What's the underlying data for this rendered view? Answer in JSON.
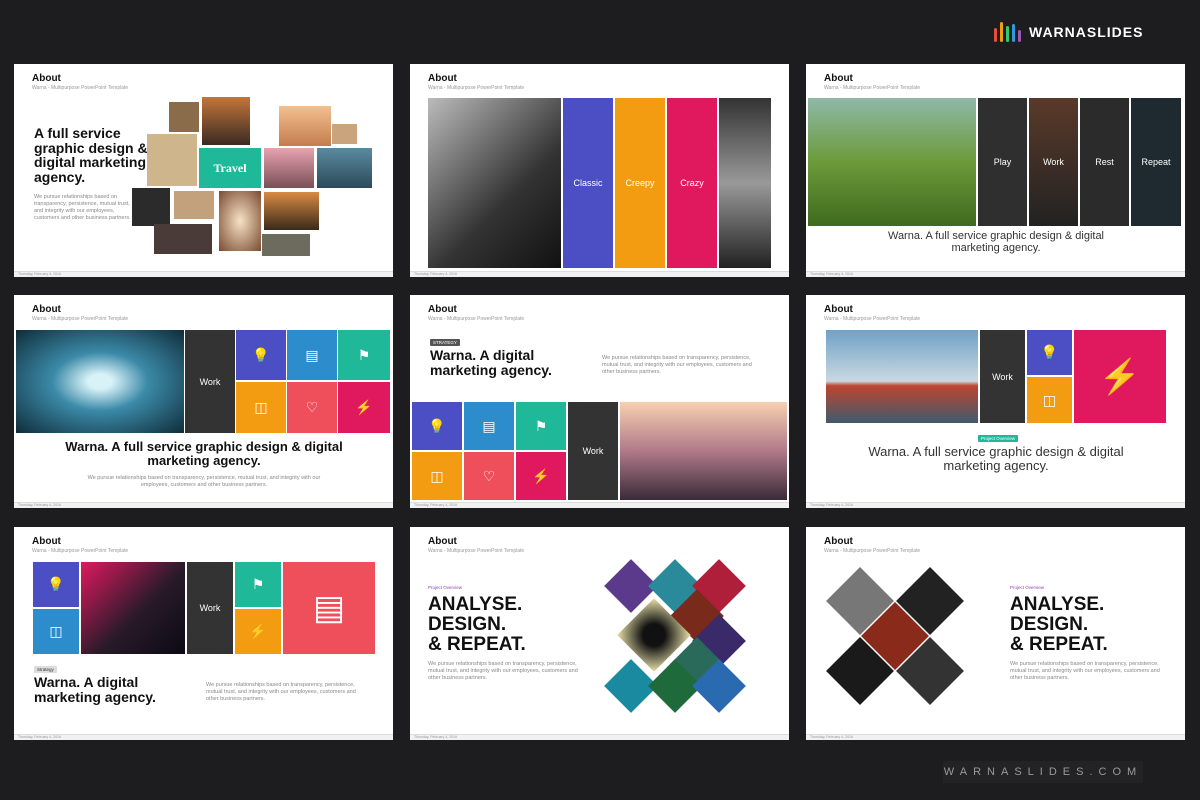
{
  "brand": {
    "name": "WARNASLIDES",
    "footer": "WARNASLIDES.COM"
  },
  "common": {
    "title": "About",
    "subtitle": "Warna - Multipurpose PowerPoint Template",
    "footer": "Thursday, February 4, 2016"
  },
  "s1": {
    "heading": "A full service graphic design & digital marketing agency.",
    "para": "We pursue relationships based on transparency, persistence, mutual trust, and integrity with our employees, customers and other business partners.",
    "tile": "Travel"
  },
  "s2": {
    "labels": [
      "Classic",
      "Creepy",
      "Crazy"
    ]
  },
  "s3": {
    "labels": [
      "Play",
      "Work",
      "Rest",
      "Repeat"
    ],
    "caption": "Warna. A full service graphic design & digital marketing agency."
  },
  "s4": {
    "work": "Work",
    "heading": "Warna. A full service graphic design & digital marketing agency.",
    "para": "We pursue relationships based on transparency, persistence, mutual trust, and integrity with our employees, customers and other business partners."
  },
  "s5": {
    "tag": "STRATEGY",
    "heading": "Warna. A digital marketing agency.",
    "para": "We pursue relationships based on transparency, persistence, mutual trust, and integrity with our employees, customers and other business partners.",
    "work": "Work"
  },
  "s6": {
    "work": "Work",
    "tag": "Project Overview",
    "caption": "Warna. A full service graphic design & digital marketing agency."
  },
  "s7": {
    "work": "Work",
    "tag": "Strategy",
    "heading": "Warna. A digital marketing agency.",
    "para": "We pursue relationships based on transparency, persistence, mutual trust, and integrity with our employees, customers and other business partners."
  },
  "s8": {
    "tag": "Project Overview",
    "heading1": "ANALYSE.",
    "heading2": "DESIGN.",
    "heading3": "& REPEAT.",
    "para": "We pursue relationships based on transparency, persistence, mutual trust, and integrity with our employees, customers and other business partners."
  },
  "s9": {
    "tag": "Project Overview",
    "heading1": "ANALYSE.",
    "heading2": "DESIGN.",
    "heading3": "& REPEAT.",
    "para": "We pursue relationships based on transparency, persistence, mutual trust, and integrity with our employees, customers and other business partners."
  },
  "colors": {
    "purple": "#4b4fc3",
    "orange": "#f39c12",
    "pink": "#e0195f",
    "teal": "#1fb99a",
    "blue": "#2d8ccc",
    "dark": "#333333",
    "coral": "#ee4f5a"
  }
}
